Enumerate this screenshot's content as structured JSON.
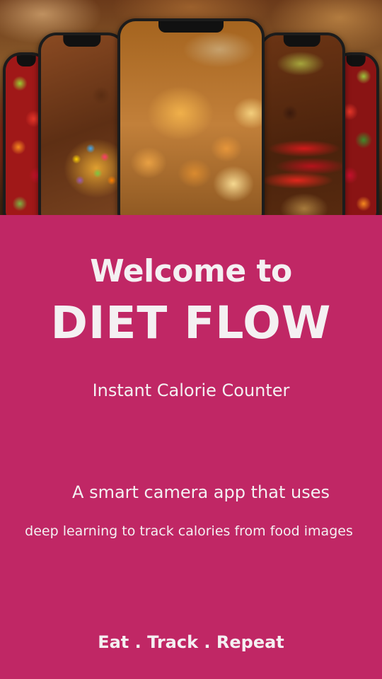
{
  "hero": {
    "images": [
      "fruits-image",
      "candies-image",
      "breads-image",
      "spices-image",
      "fruits-image"
    ]
  },
  "welcome": {
    "line1": "Welcome to",
    "app_name": "DIET FLOW",
    "subtitle": "Instant Calorie Counter",
    "description_line1": "A smart camera app that uses",
    "description_line2": "deep learning to track calories from food images",
    "tagline": "Eat . Track . Repeat"
  },
  "colors": {
    "background": "#c02765",
    "text": "#f4f0f2"
  }
}
